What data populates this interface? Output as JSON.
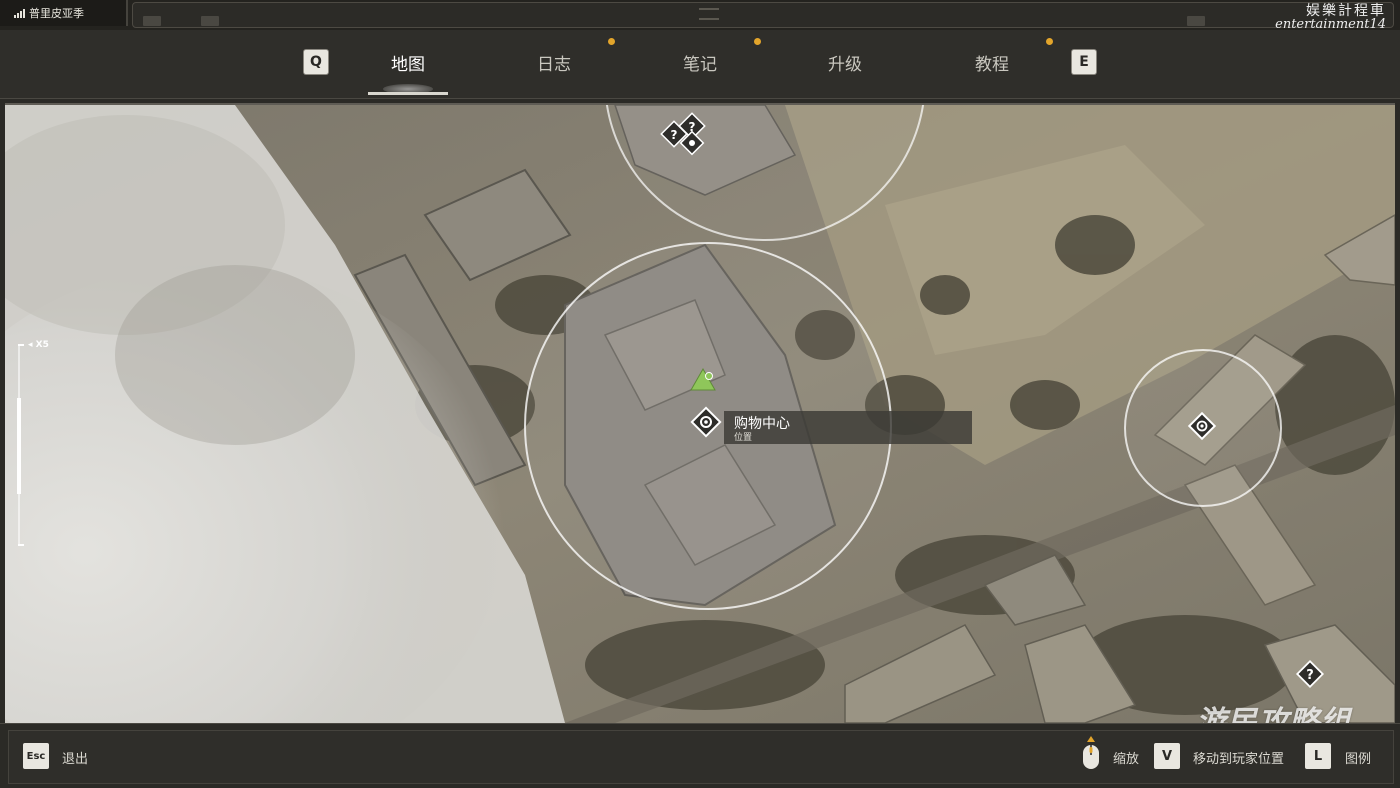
{
  "status": {
    "location": "普里皮亚季"
  },
  "watermarks": {
    "top_line1": "娱樂計程車",
    "top_line2": "entertainment14",
    "bottom": "游民攻略组"
  },
  "tabs": {
    "prev_key": "Q",
    "next_key": "E",
    "items": [
      {
        "label": "地图",
        "active": true,
        "notification": false
      },
      {
        "label": "日志",
        "active": false,
        "notification": true
      },
      {
        "label": "笔记",
        "active": false,
        "notification": true
      },
      {
        "label": "升级",
        "active": false,
        "notification": false
      },
      {
        "label": "教程",
        "active": false,
        "notification": true
      }
    ]
  },
  "map": {
    "zoom_label": "X5",
    "selected_poi": {
      "title": "购物中心",
      "subtitle": "位置"
    },
    "icons": [
      "player-icon",
      "location-marker-icon",
      "unknown-marker-icon"
    ]
  },
  "footer": {
    "exit": {
      "key": "Esc",
      "label": "退出"
    },
    "zoom": {
      "icon": "mouse-icon",
      "label": "缩放"
    },
    "move_to_player": {
      "key": "V",
      "label": "移动到玩家位置"
    },
    "legend": {
      "key": "L",
      "label": "图例"
    }
  },
  "colors": {
    "accent_dot": "#e3a52b",
    "player": "#8fc65a",
    "panel": "#2f2e2a"
  }
}
